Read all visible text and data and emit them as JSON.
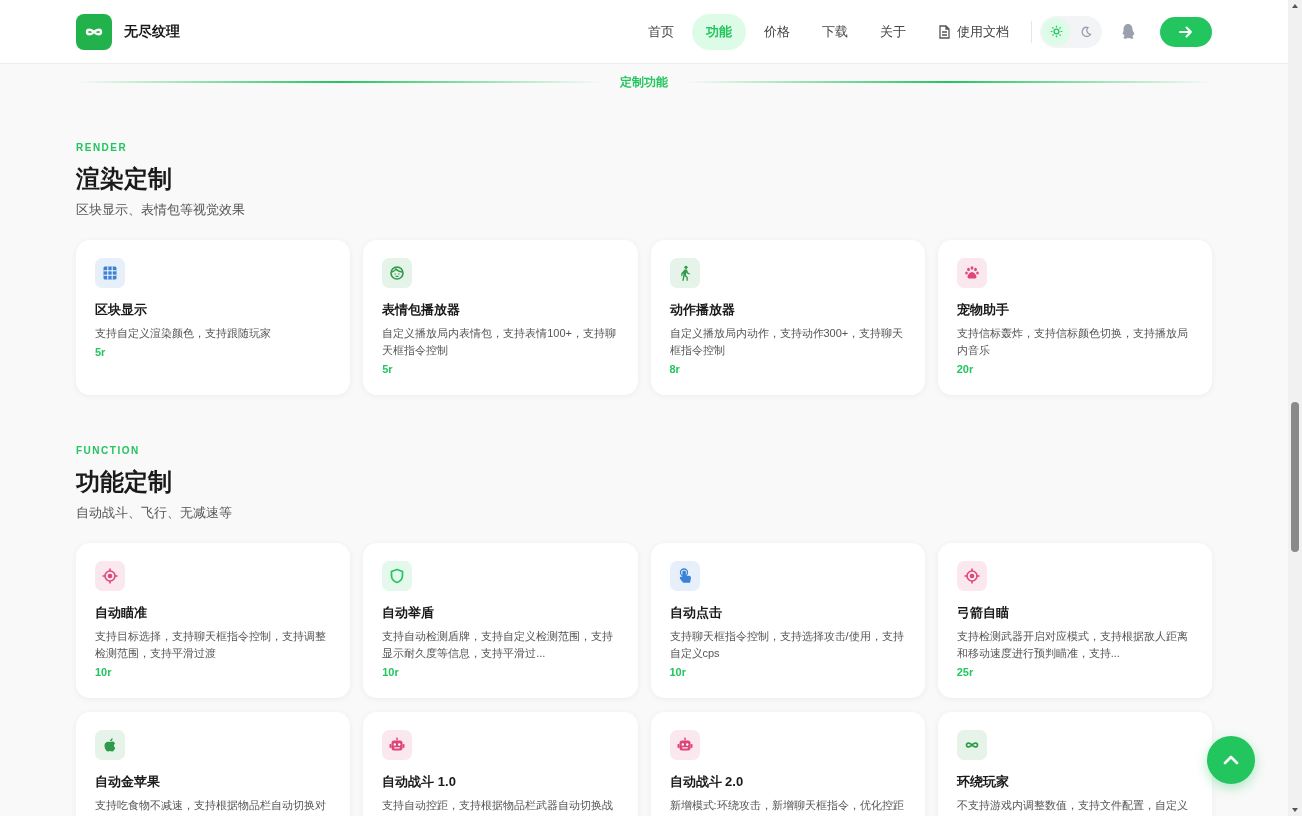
{
  "header": {
    "brand": "无尽纹理",
    "nav": [
      {
        "label": "首页",
        "selected": false
      },
      {
        "label": "功能",
        "selected": true
      },
      {
        "label": "价格",
        "selected": false
      },
      {
        "label": "下载",
        "selected": false
      },
      {
        "label": "关于",
        "selected": false
      }
    ],
    "docs_link": "使用文档",
    "theme": [
      {
        "selected": true
      },
      {
        "selected": false
      }
    ]
  },
  "divider_label": "定制功能",
  "sections": [
    {
      "eyebrow": "RENDER",
      "title": "渲染定制",
      "subtitle": "区块显示、表情包等视觉效果",
      "cards": [
        {
          "title": "区块显示",
          "description": "支持自定义渲染颜色，支持跟随玩家",
          "price": "5r",
          "color": "#3b82d6"
        },
        {
          "title": "表情包播放器",
          "description": "自定义播放局内表情包，支持表情100+，支持聊天框指令控制",
          "price": "5r",
          "color": "#2e9a4a"
        },
        {
          "title": "动作播放器",
          "description": "自定义播放局内动作，支持动作300+，支持聊天框指令控制",
          "price": "8r",
          "color": "#2e9a4a"
        },
        {
          "title": "宠物助手",
          "description": "支持信标轰炸，支持信标颜色切换，支持播放局内音乐",
          "price": "20r",
          "color": "#e0457a"
        }
      ]
    },
    {
      "eyebrow": "FUNCTION",
      "title": "功能定制",
      "subtitle": "自动战斗、飞行、无减速等",
      "cards": [
        {
          "title": "自动瞄准",
          "description": "支持目标选择，支持聊天框指令控制，支持调整检测范围，支持平滑过渡",
          "price": "10r",
          "color": "#e0457a"
        },
        {
          "title": "自动举盾",
          "description": "支持自动检测盾牌，支持自定义检测范围，支持显示耐久度等信息，支持平滑过...",
          "price": "10r",
          "color": "#22c55e"
        },
        {
          "title": "自动点击",
          "description": "支持聊天框指令控制，支持选择攻击/使用，支持自定义cps",
          "price": "10r",
          "color": "#3b82d6"
        },
        {
          "title": "弓箭自瞄",
          "description": "支持检测武器开启对应模式，支持根据敌人距离和移动速度进行预判瞄准，支持...",
          "price": "25r",
          "color": "#e0457a"
        },
        {
          "title": "自动金苹果",
          "description": "支持吃食物不减速，支持根据物品栏自动切换对",
          "color": "#2e9a4a"
        },
        {
          "title": "自动战斗 1.0",
          "description": "支持自动控距，支持根据物品栏武器自动切换战",
          "color": "#e0457a"
        },
        {
          "title": "自动战斗 2.0",
          "description": "新增模式:环绕攻击，新增聊天框指令，优化控距",
          "color": "#e0457a"
        },
        {
          "title": "环绕玩家",
          "description": "不支持游戏内调整数值，支持文件配置，自定义",
          "color": "#2e9a4a"
        }
      ]
    }
  ]
}
